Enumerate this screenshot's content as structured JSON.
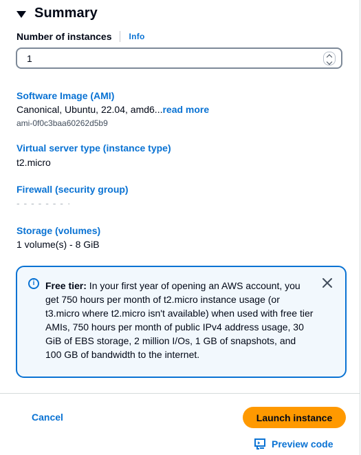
{
  "summary": {
    "title": "Summary",
    "instances": {
      "label": "Number of instances",
      "info": "Info",
      "value": "1"
    },
    "ami": {
      "title": "Software Image (AMI)",
      "value": "Canonical, Ubuntu, 22.04, amd6...",
      "read_more": "read more",
      "id": "ami-0f0c3baa60262d5b9"
    },
    "instance_type": {
      "title": "Virtual server type (instance type)",
      "value": "t2.micro"
    },
    "firewall": {
      "title": "Firewall (security group)",
      "value": "- - - -  - - - ·"
    },
    "storage": {
      "title": "Storage (volumes)",
      "value": "1 volume(s) - 8 GiB"
    }
  },
  "alert": {
    "heading": "Free tier:",
    "body": " In your first year of opening an AWS account, you get 750 hours per month of t2.micro instance usage (or t3.micro where t2.micro isn't available) when used with free tier AMIs, 750 hours per month of public IPv4 address usage, 30 GiB of EBS storage, 2 million I/Os, 1 GB of snapshots, and 100 GB of bandwidth to the internet.",
    "icon": "info-icon"
  },
  "footer": {
    "cancel": "Cancel",
    "launch": "Launch instance",
    "preview": "Preview code"
  },
  "colors": {
    "link": "#0972d3",
    "primary_button": "#ff9900",
    "alert_bg": "#f2f8fd",
    "alert_border": "#0972d3"
  }
}
